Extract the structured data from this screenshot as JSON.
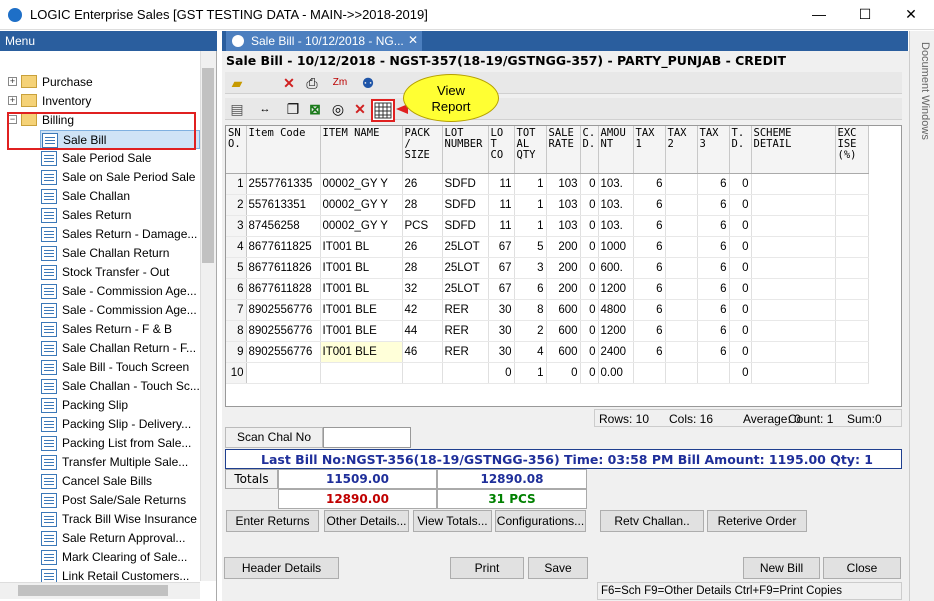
{
  "window": {
    "title": "LOGIC Enterprise Sales  [GST TESTING DATA - MAIN->>2018-2019]",
    "minimize": "—",
    "maximize": "☐",
    "close": "✕"
  },
  "menu": {
    "header": "Menu",
    "pin": "📌",
    "top_items": [
      {
        "label": "Purchase",
        "toggle": "+"
      },
      {
        "label": "Inventory",
        "toggle": "+"
      },
      {
        "label": "Billing",
        "toggle": "−"
      }
    ],
    "billing_items": [
      "Sale Bill",
      "Sale Period Sale",
      "Sale on Sale Period Sale",
      "Sale Challan",
      "Sales Return",
      "Sales Return - Damage...",
      "Sale Challan Return",
      "Stock Transfer - Out",
      "Sale - Commission Age...",
      "Sale - Commission Age...",
      "Sales Return - F & B",
      "Sale Challan Return - F...",
      "Sale Bill - Touch Screen",
      "Sale Challan - Touch Sc...",
      "Packing Slip",
      "Packing Slip - Delivery...",
      "Packing List from Sale...",
      "Transfer Multiple Sale...",
      "Cancel Sale Bills",
      "Post Sale/Sale Returns",
      "Track Bill Wise Insurance",
      "Sale Return Approval...",
      "Mark Clearing of Sale...",
      "Link Retail Customers..."
    ]
  },
  "doc_tab": {
    "label": "Sale Bill - 10/12/2018 - NG...",
    "close": "✕"
  },
  "right_rail": "Document Windows",
  "bill_title": "Sale Bill - 10/12/2018 - NGST-357(18-19/GSTNGG-357) - PARTY_PUNJAB - CREDIT",
  "callout": "View Report",
  "grid": {
    "headers": [
      "SN O.",
      "Item Code",
      "ITEM NAME",
      "PACK / SIZE",
      "LOT NUMBER",
      "LO T CO",
      "TOT AL QTY",
      "SALE RATE",
      "C. D.",
      "AMOU NT",
      "TAX 1",
      "TAX 2",
      "TAX 3",
      "T. D.",
      "SCHEME DETAIL",
      "EXC ISE (%)"
    ],
    "rows": [
      [
        "1",
        "2557761335",
        "00002_GY Y",
        "26",
        "SDFD",
        "11",
        "1",
        "103",
        "0",
        "103.",
        "6",
        "",
        "6",
        "0",
        "",
        ""
      ],
      [
        "2",
        "557613351",
        "00002_GY Y",
        "28",
        "SDFD",
        "11",
        "1",
        "103",
        "0",
        "103.",
        "6",
        "",
        "6",
        "0",
        "",
        ""
      ],
      [
        "3",
        "87456258",
        "00002_GY Y",
        "PCS",
        "SDFD",
        "11",
        "1",
        "103",
        "0",
        "103.",
        "6",
        "",
        "6",
        "0",
        "",
        ""
      ],
      [
        "4",
        "8677611825",
        "IT001 BL",
        "26",
        "25LOT",
        "67",
        "5",
        "200",
        "0",
        "1000",
        "6",
        "",
        "6",
        "0",
        "",
        ""
      ],
      [
        "5",
        "8677611826",
        "IT001 BL",
        "28",
        "25LOT",
        "67",
        "3",
        "200",
        "0",
        "600.",
        "6",
        "",
        "6",
        "0",
        "",
        ""
      ],
      [
        "6",
        "8677611828",
        "IT001 BL",
        "32",
        "25LOT",
        "67",
        "6",
        "200",
        "0",
        "1200",
        "6",
        "",
        "6",
        "0",
        "",
        ""
      ],
      [
        "7",
        "8902556776",
        "IT001 BLE",
        "42",
        "RER",
        "30",
        "8",
        "600",
        "0",
        "4800",
        "6",
        "",
        "6",
        "0",
        "",
        ""
      ],
      [
        "8",
        "8902556776",
        "IT001 BLE",
        "44",
        "RER",
        "30",
        "2",
        "600",
        "0",
        "1200",
        "6",
        "",
        "6",
        "0",
        "",
        ""
      ],
      [
        "9",
        "8902556776",
        "IT001 BLE",
        "46",
        "RER",
        "30",
        "4",
        "600",
        "0",
        "2400",
        "6",
        "",
        "6",
        "0",
        "",
        ""
      ],
      [
        "10",
        "",
        "",
        "",
        "",
        "0",
        "1",
        "0",
        "0",
        "0.00",
        "",
        "",
        "",
        "0",
        "",
        ""
      ]
    ]
  },
  "grid_status": {
    "rows": "Rows: 10",
    "cols": "Cols: 16",
    "average": "Average: 0",
    "count": "Count: 1",
    "sum": "Sum:0"
  },
  "scan": {
    "label": "Scan Chal No",
    "value": ""
  },
  "last_bill": "Last Bill No:NGST-356(18-19/GSTNGG-356)  Time: 03:58 PM   Bill Amount: 1195.00  Qty: 1",
  "totals": {
    "label": "Totals",
    "amount_blue": "11509.00",
    "amount_blue2": "12890.08",
    "amount_red": "12890.00",
    "qty_green": "31 PCS"
  },
  "colors": {
    "blue": "#1f2f9a",
    "red": "#c00000",
    "green": "#008000"
  },
  "buttons": {
    "enter_returns": "Enter Returns",
    "other_details": "Other Details...",
    "view_totals": "View Totals...",
    "configurations": "Configurations...",
    "retv_challan": "Retv Challan..",
    "retrieve_order": "Reterive Order",
    "header_details": "Header Details",
    "print": "Print",
    "save": "Save",
    "new_bill": "New Bill",
    "close": "Close"
  },
  "hint": "F6=Sch  F9=Other Details  Ctrl+F9=Print Copies",
  "toolbar1": [
    "open-folder-icon",
    "delete-x-icon",
    "printer-icon",
    "zoom-icon",
    "users-icon"
  ],
  "toolbar2": [
    "calculator-icon",
    "column-width-icon",
    "copy-icon",
    "excel-icon",
    "binoculars-icon",
    "delete-x-icon",
    "grid-report-icon"
  ]
}
